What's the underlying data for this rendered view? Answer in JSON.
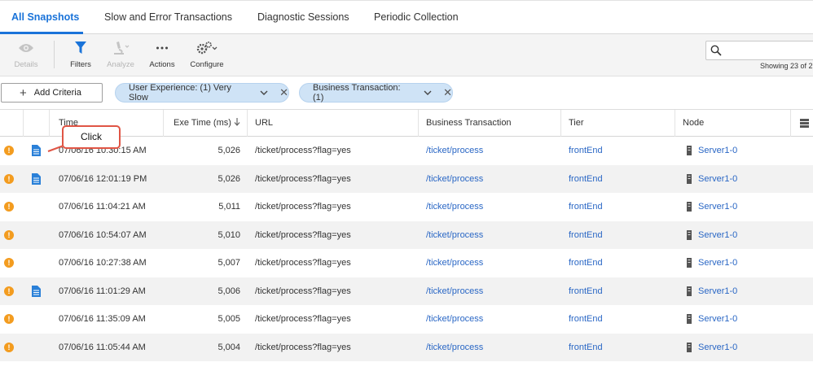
{
  "tabs": [
    {
      "label": "All Snapshots",
      "active": true
    },
    {
      "label": "Slow and Error Transactions",
      "active": false
    },
    {
      "label": "Diagnostic Sessions",
      "active": false
    },
    {
      "label": "Periodic Collection",
      "active": false
    }
  ],
  "toolbar": {
    "details_label": "Details",
    "filters_label": "Filters",
    "analyze_label": "Analyze",
    "actions_label": "Actions",
    "configure_label": "Configure",
    "search_placeholder": "",
    "showing_text": "Showing 23 of 2"
  },
  "criteria": {
    "add_label": "Add Criteria",
    "filters": [
      {
        "label": "User Experience: (1) Very Slow"
      },
      {
        "label": "Business Transaction: (1)"
      }
    ]
  },
  "table": {
    "headers": {
      "time": "Time",
      "exe": "Exe Time (ms)",
      "url": "URL",
      "bt": "Business Transaction",
      "tier": "Tier",
      "node": "Node"
    },
    "rows": [
      {
        "time": "07/06/16 10:30:15 AM",
        "exe": "5,026",
        "url": "/ticket/process?flag=yes",
        "bt": "/ticket/process",
        "tier": "frontEnd",
        "node": "Server1-0",
        "doc": true
      },
      {
        "time": "07/06/16 12:01:19 PM",
        "exe": "5,026",
        "url": "/ticket/process?flag=yes",
        "bt": "/ticket/process",
        "tier": "frontEnd",
        "node": "Server1-0",
        "doc": true
      },
      {
        "time": "07/06/16 11:04:21 AM",
        "exe": "5,011",
        "url": "/ticket/process?flag=yes",
        "bt": "/ticket/process",
        "tier": "frontEnd",
        "node": "Server1-0",
        "doc": false
      },
      {
        "time": "07/06/16 10:54:07 AM",
        "exe": "5,010",
        "url": "/ticket/process?flag=yes",
        "bt": "/ticket/process",
        "tier": "frontEnd",
        "node": "Server1-0",
        "doc": false
      },
      {
        "time": "07/06/16 10:27:38 AM",
        "exe": "5,007",
        "url": "/ticket/process?flag=yes",
        "bt": "/ticket/process",
        "tier": "frontEnd",
        "node": "Server1-0",
        "doc": false
      },
      {
        "time": "07/06/16 11:01:29 AM",
        "exe": "5,006",
        "url": "/ticket/process?flag=yes",
        "bt": "/ticket/process",
        "tier": "frontEnd",
        "node": "Server1-0",
        "doc": true
      },
      {
        "time": "07/06/16 11:35:09 AM",
        "exe": "5,005",
        "url": "/ticket/process?flag=yes",
        "bt": "/ticket/process",
        "tier": "frontEnd",
        "node": "Server1-0",
        "doc": false
      },
      {
        "time": "07/06/16 11:05:44 AM",
        "exe": "5,004",
        "url": "/ticket/process?flag=yes",
        "bt": "/ticket/process",
        "tier": "frontEnd",
        "node": "Server1-0",
        "doc": false
      }
    ]
  },
  "callout": {
    "label": "Click"
  },
  "colors": {
    "accent": "#1a73d9",
    "link": "#2a67c5",
    "warning": "#f39c1f",
    "pill": "#cfe3f6",
    "callout_border": "#e05545"
  }
}
